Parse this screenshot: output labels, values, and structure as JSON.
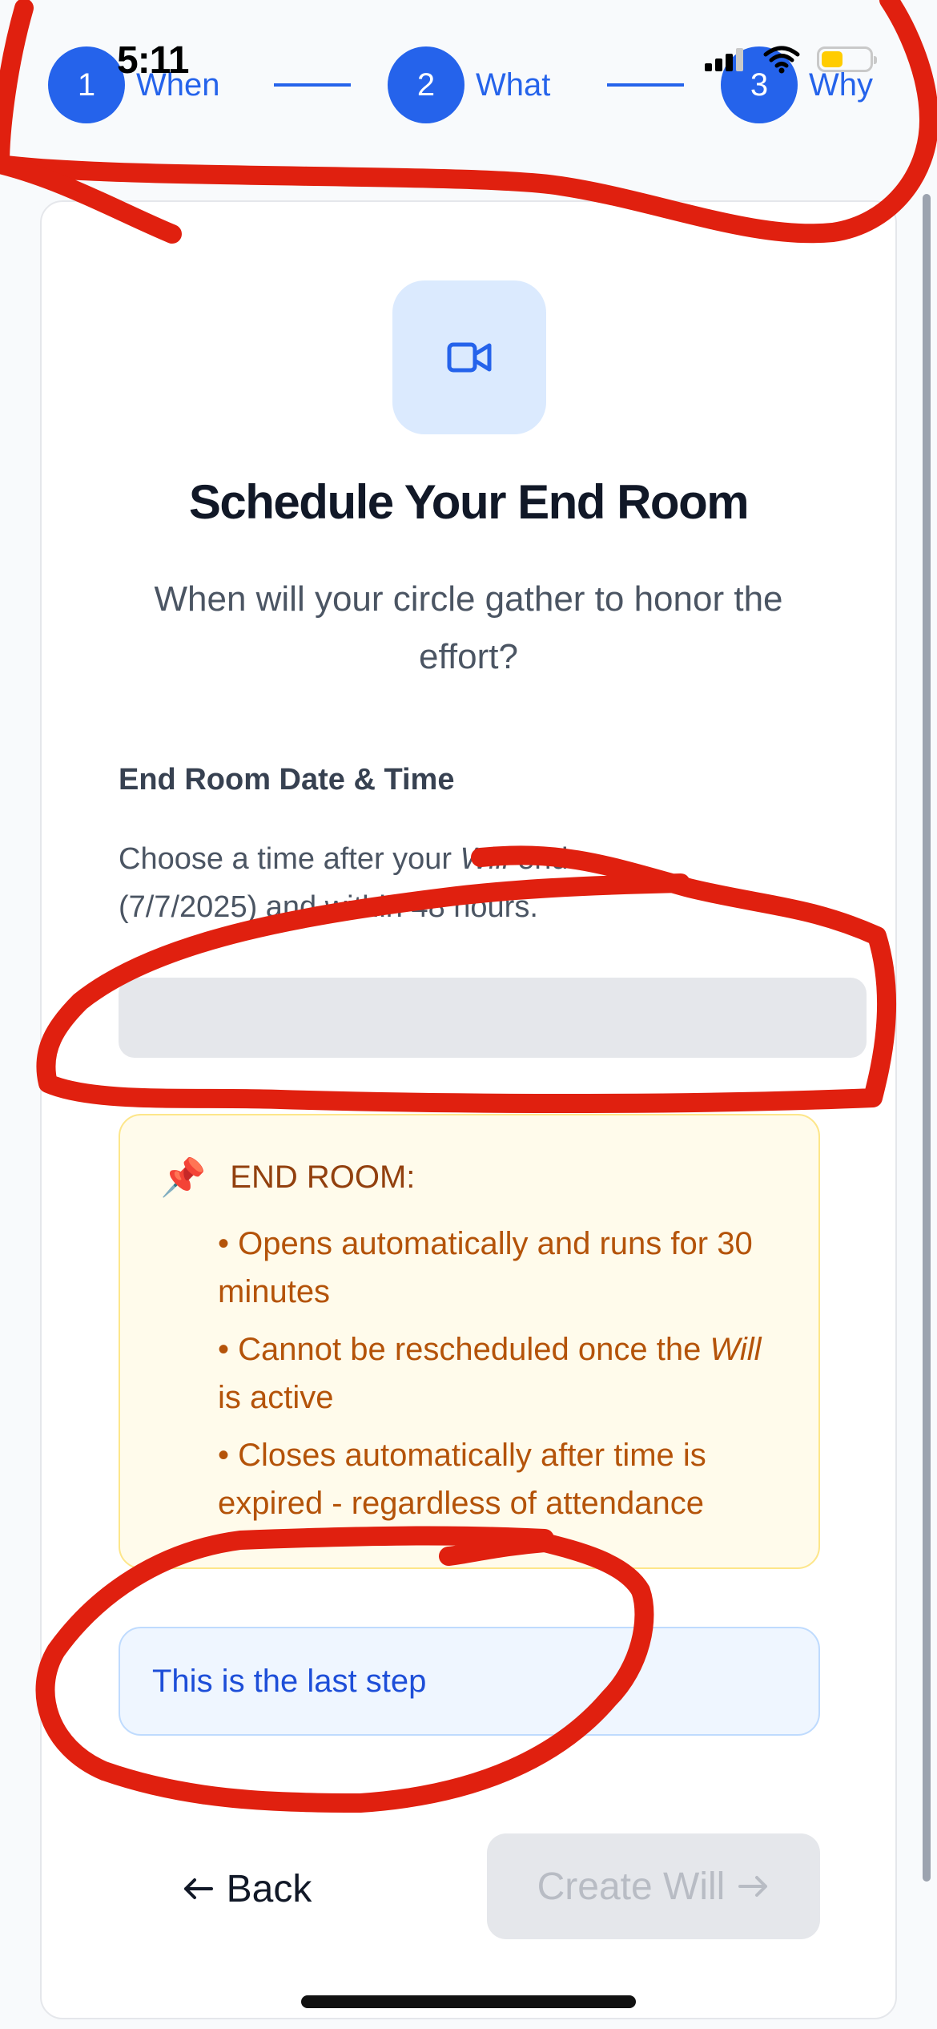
{
  "status_bar": {
    "time": "5:11",
    "icons": [
      "signal-icon",
      "wifi-icon",
      "battery-icon"
    ],
    "battery_level": 0.45,
    "battery_color": "#ffcc00"
  },
  "stepper": {
    "accent_color": "#2563eb",
    "steps": [
      {
        "number": "1",
        "label": "When"
      },
      {
        "number": "2",
        "label": "What"
      },
      {
        "number": "3",
        "label": "Why"
      }
    ]
  },
  "main": {
    "icon": "video-icon",
    "title": "Schedule Your End Room",
    "subtitle": "When will your circle gather to honor the effort?",
    "field": {
      "label": "End Room Date & Time",
      "help_prefix": "Choose a time after your ",
      "help_italic": "Will",
      "help_suffix": " ends (7/7/2025) and within 48 hours.",
      "value": ""
    },
    "info": {
      "icon": "pushpin-icon",
      "title": "END ROOM:",
      "items": [
        {
          "text": "• Opens automatically and runs for 30 minutes"
        },
        {
          "prefix": "• Cannot be rescheduled once the ",
          "italic": "Will",
          "suffix": " is active"
        },
        {
          "text": "• Closes automatically after time is expired - regardless of attendance"
        }
      ]
    },
    "notice": "This is the last step"
  },
  "actions": {
    "back_label": "Back",
    "create_label": "Create Will",
    "create_enabled": false
  },
  "markup": {
    "color": "#e0200f"
  }
}
